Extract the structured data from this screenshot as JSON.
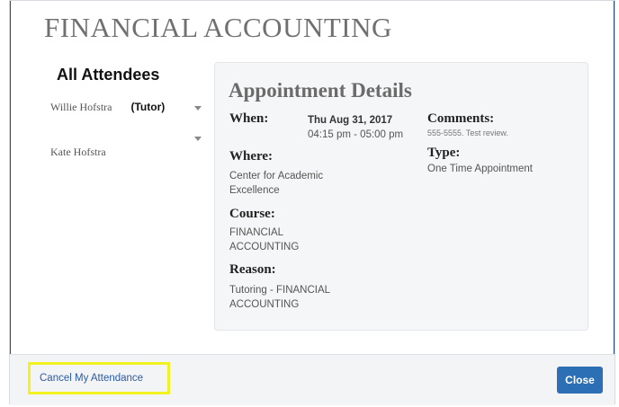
{
  "dialog": {
    "title": "FINANCIAL ACCOUNTING"
  },
  "attendees": {
    "heading": "All Attendees",
    "items": [
      {
        "name": "Willie Hofstra",
        "role": "(Tutor)"
      },
      {
        "name": "Kate Hofstra",
        "role": ""
      }
    ]
  },
  "details": {
    "heading": "Appointment Details",
    "when_label": "When:",
    "when_date": "Thu Aug 31, 2017",
    "when_time": "04:15 pm - 05:00 pm",
    "comments_label": "Comments:",
    "comments_value": "555-5555. Test review.",
    "where_label": "Where:",
    "where_line1": "Center for Academic",
    "where_line2": "Excellence",
    "type_label": "Type:",
    "type_value": "One Time Appointment",
    "course_label": "Course:",
    "course_line1": "FINANCIAL",
    "course_line2": "ACCOUNTING",
    "reason_label": "Reason:",
    "reason_line1": "Tutoring - FINANCIAL",
    "reason_line2": "ACCOUNTING"
  },
  "footer": {
    "cancel_label": "Cancel My Attendance",
    "close_label": "Close"
  },
  "colors": {
    "accent": "#2d6fb5",
    "highlight": "#f2f220",
    "link": "#2b5aa6"
  }
}
